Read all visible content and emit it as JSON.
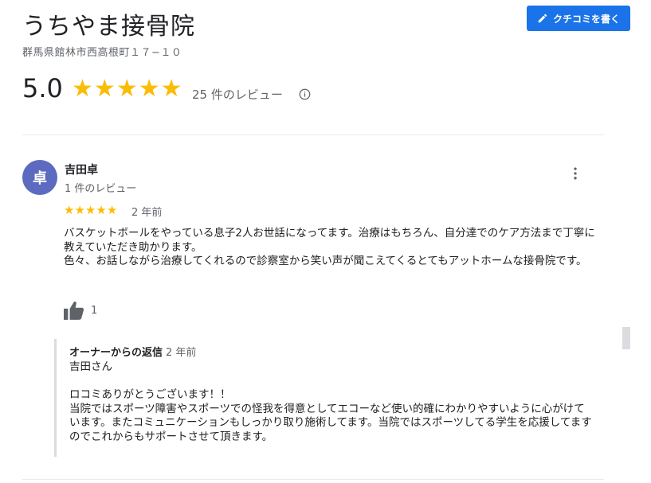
{
  "place": {
    "title": "うちやま接骨院",
    "address": "群馬県館林市西高根町１７−１０",
    "rating": "5.0",
    "star_count": 5,
    "review_count_text": "25 件のレビュー",
    "write_review_label": "クチコミを書く"
  },
  "review": {
    "avatar_letter": "卓",
    "avatar_color": "#5c6bc0",
    "reviewer_name": "吉田卓",
    "reviewer_review_count": "1 件のレビュー",
    "stars": 5,
    "time": "2 年前",
    "text_lines": [
      "バスケットボールをやっている息子2人お世話になってます。治療はもちろん、自分達でのケア方法まで丁寧に教えていただき助かります。",
      "色々、お話しながら治療してくれるので診察室から笑い声が聞こえてくるとてもアットホームな接骨院です。"
    ],
    "like_count": "1"
  },
  "owner_reply": {
    "label": "オーナーからの返信",
    "time": "2 年前",
    "lines": [
      "吉田さん",
      "",
      "ロコミありがとうございます！！",
      "当院ではスポーツ障害やスポーツでの怪我を得意としてエコーなど使い的確にわかりやすいように心がけています。またコミュニケーションもしっかり取り施術してます。当院ではスポーツしてる学生を応援してますのでこれからもサポートさせて頂きます。"
    ]
  },
  "colors": {
    "accent": "#1a73e8",
    "star": "#fbbc04"
  },
  "icons": [
    "pencil-icon",
    "star-icon",
    "info-icon",
    "more-vert-icon",
    "thumb-up-icon"
  ]
}
